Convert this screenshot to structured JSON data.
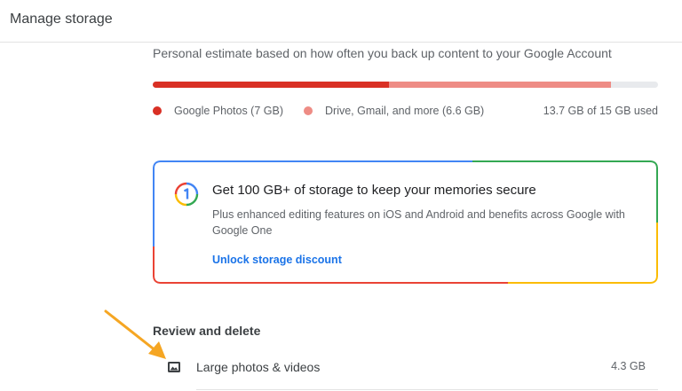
{
  "header": {
    "title": "Manage storage"
  },
  "storage": {
    "estimate_text": "Personal estimate based on how often you back up content to your Google Account",
    "usage_fraction": 0.913,
    "segments": [
      {
        "label": "Google Photos (7 GB)",
        "gb": 7,
        "color": "#d93025"
      },
      {
        "label": "Drive, Gmail, and more (6.6 GB)",
        "gb": 6.6,
        "color": "#ee8c85"
      }
    ],
    "total_gb": 15,
    "usage_text": "13.7 GB of 15 GB used",
    "track_color": "#e8eaed"
  },
  "promo": {
    "title": "Get 100 GB+ of storage to keep your memories secure",
    "description": "Plus enhanced editing features on iOS and Android and benefits across Google with Google One",
    "link_label": "Unlock storage discount",
    "logo_icon": "google-one-icon",
    "border_colors": [
      "#4285f4",
      "#34a853",
      "#fbbc04",
      "#ea4335"
    ]
  },
  "review": {
    "section_title": "Review and delete",
    "items": [
      {
        "label": "Large photos & videos",
        "size": "4.3 GB",
        "icon": "photo-icon"
      }
    ]
  },
  "annotation": {
    "arrow_color": "#f5a623"
  }
}
